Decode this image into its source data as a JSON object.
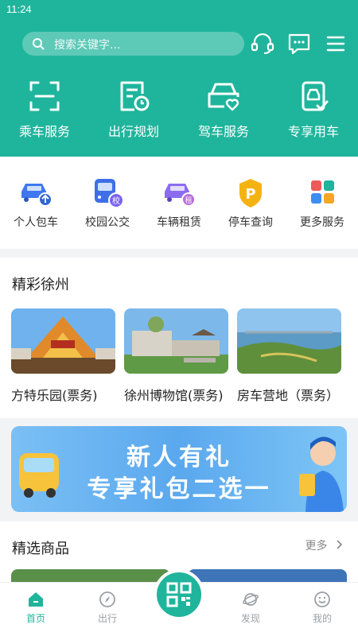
{
  "status_bar": {
    "time": "11:24"
  },
  "header": {
    "search_placeholder": "搜索关键字...",
    "main_services": [
      {
        "label": "乘车服务",
        "icon": "scan-frame-icon"
      },
      {
        "label": "出行规划",
        "icon": "schedule-clock-icon"
      },
      {
        "label": "驾车服务",
        "icon": "car-heart-icon"
      },
      {
        "label": "专享用车",
        "icon": "phone-car-icon"
      }
    ]
  },
  "services": [
    {
      "label": "个人包车",
      "icon": "car-arrow-icon"
    },
    {
      "label": "校园公交",
      "icon": "school-bus-icon"
    },
    {
      "label": "车辆租赁",
      "icon": "car-rent-icon"
    },
    {
      "label": "停车查询",
      "icon": "parking-icon"
    },
    {
      "label": "更多服务",
      "icon": "grid-icon"
    }
  ],
  "section_jingcai": {
    "title": "精彩徐州",
    "cards": [
      {
        "name": "方特乐园(票务)"
      },
      {
        "name": "徐州博物馆(票务)"
      },
      {
        "name": "房车营地（票务）"
      }
    ]
  },
  "banner": {
    "line1": "新人有礼",
    "line2": "专享礼包二选一"
  },
  "section_jingxuan": {
    "title": "精选商品",
    "more": "更多"
  },
  "tabbar": [
    {
      "label": "首页",
      "icon": "home-icon",
      "active": true
    },
    {
      "label": "出行",
      "icon": "compass-icon",
      "active": false
    },
    {
      "label": "发现",
      "icon": "planet-icon",
      "active": false
    },
    {
      "label": "我的",
      "icon": "smile-icon",
      "active": false
    }
  ],
  "colors": {
    "brand": "#1fb59c",
    "background": "#f2f3f5"
  }
}
